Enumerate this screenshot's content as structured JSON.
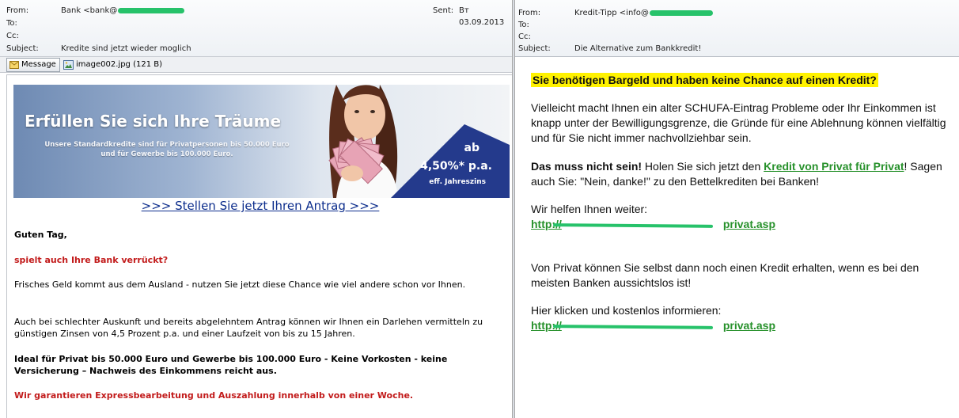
{
  "left": {
    "header": {
      "from_label": "From:",
      "from_value": "Bank <bank@",
      "sent_label": "Sent:",
      "sent_value": "Вт 03.09.2013",
      "to_label": "To:",
      "cc_label": "Cc:",
      "subject_label": "Subject:",
      "subject_value": "Kredite sind jetzt wieder moglich"
    },
    "toolbar": {
      "message_tab": "Message",
      "attachment": "image002.jpg (121 B)"
    },
    "banner": {
      "title": "Erfüllen Sie sich Ihre Träume",
      "subtitle": "Unsere Standardkredite sind für Privatpersonen bis 50.000 Euro und für Gewerbe bis 100.000 Euro.",
      "rate_prefix": "ab",
      "rate": "4,50%* p.a.",
      "rate_note": "eff. Jahreszins"
    },
    "cta": ">>> Stellen Sie jetzt Ihren Antrag >>>",
    "body": {
      "greeting": "Guten Tag,",
      "hook": "spielt auch Ihre Bank verrückt?",
      "p1": "Frisches Geld kommt aus dem Ausland - nutzen Sie jetzt diese Chance wie viel andere schon vor Ihnen.",
      "p2": "Auch bei schlechter Auskunft und bereits abgelehntem Antrag können wir Ihnen ein Darlehen vermitteln zu günstigen Zinsen von 4,5 Prozent p.a. und einer Laufzeit von bis zu 15 Jahren.",
      "p3": "Ideal für Privat bis 50.000 Euro und Gewerbe bis 100.000 Euro - Keine Vorkosten - keine Versicherung – Nachweis des Einkommens reicht aus.",
      "p4": "Wir garantieren Expressbearbeitung und Auszahlung innerhalb von einer Woche."
    }
  },
  "right": {
    "header": {
      "from_label": "From:",
      "from_value": "Kredit-Tipp <info@",
      "to_label": "To:",
      "cc_label": "Cc:",
      "subject_label": "Subject:",
      "subject_value": "Die Alternative zum Bankkredit!"
    },
    "body": {
      "headline": "Sie benötigen Bargeld und haben keine Chance auf einen Kredit?",
      "p1": "Vielleicht macht Ihnen ein alter SCHUFA-Eintrag Probleme oder Ihr Einkommen ist knapp unter der Bewilligungsgrenze, die Gründe für eine Ablehnung können vielfältig und für Sie nicht immer nachvollziehbar sein.",
      "p2_bold": "Das muss nicht sein!",
      "p2_mid": " Holen Sie sich jetzt den ",
      "p2_link": "Kredit von Privat für Privat",
      "p2_end": "! Sagen auch Sie: \"Nein, danke!\" zu den Bettelkrediten bei Banken!",
      "help_label": "Wir helfen Ihnen weiter:",
      "link1_start": "http://",
      "link1_end": "privat.asp",
      "p3": "Von Privat können Sie selbst dann noch einen Kredit erhalten, wenn es bei den meisten Banken aussichtslos ist!",
      "info_label": "Hier klicken und kostenlos informieren:",
      "link2_start": "http://",
      "link2_end": "privat.asp"
    }
  },
  "colors": {
    "redaction": "#27c26a",
    "link_green": "#27912b",
    "alert_red": "#c21b1b",
    "highlight_yellow": "#fff200",
    "banner_navy": "#243a8c"
  }
}
